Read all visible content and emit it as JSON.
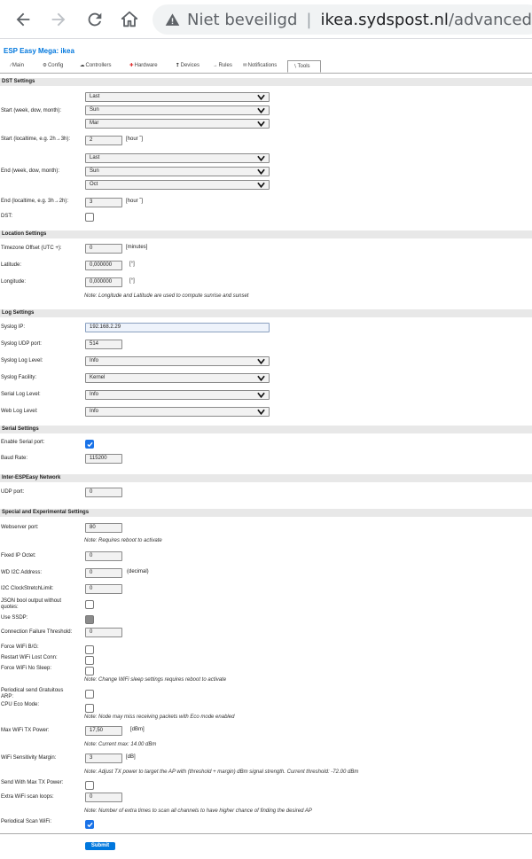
{
  "browser": {
    "security_label": "Niet beveiligd",
    "url_host": "ikea.sydspost.nl",
    "url_path": "/advanced"
  },
  "app": {
    "title": "ESP Easy Mega: ikea",
    "accent_color": "#0077dd"
  },
  "tabs": [
    {
      "label": "Main",
      "icon": "main-icon"
    },
    {
      "label": "Config",
      "icon": "gear-icon"
    },
    {
      "label": "Controllers",
      "icon": "cloud-icon"
    },
    {
      "label": "Hardware",
      "icon": "pin-icon"
    },
    {
      "label": "Devices",
      "icon": "bulb-icon"
    },
    {
      "label": "Rules",
      "icon": "arrow-icon"
    },
    {
      "label": "Notifications",
      "icon": "mail-icon"
    },
    {
      "label": "Tools",
      "icon": "wrench-icon",
      "active": true
    }
  ],
  "dst": {
    "header": "DST Settings",
    "start_label": "Start (week, dow, month):",
    "start_week": "Last",
    "start_dow": "Sun",
    "start_month": "Mar",
    "start_time_label": "Start (localtime, e.g. 2h→3h):",
    "start_time": "2",
    "start_time_unit": "[hour ˜]",
    "end_label": "End (week, dow, month):",
    "end_week": "Last",
    "end_dow": "Sun",
    "end_month": "Oct",
    "end_time_label": "End (localtime, e.g. 3h→2h):",
    "end_time": "3",
    "end_time_unit": "[hour ˜]",
    "dst_label": "DST:"
  },
  "location": {
    "header": "Location Settings",
    "tz_label": "Timezone Offset (UTC +):",
    "tz_value": "0",
    "tz_unit": "[minutes]",
    "lat_label": "Latitude:",
    "lat_value": "0,000000",
    "lat_unit": "[°]",
    "lon_label": "Longitude:",
    "lon_value": "0,000000",
    "lon_unit": "[°]",
    "note": "Note: Longitude and Latitude are used to compute sunrise and sunset"
  },
  "log": {
    "header": "Log Settings",
    "syslog_ip_label": "Syslog IP:",
    "syslog_ip": "192.168.2.29",
    "syslog_port_label": "Syslog UDP port:",
    "syslog_port": "514",
    "syslog_level_label": "Syslog Log Level:",
    "syslog_level": "Info",
    "facility_label": "Syslog Facility:",
    "facility": "Kernel",
    "serial_level_label": "Serial Log Level:",
    "serial_level": "Info",
    "web_level_label": "Web Log Level:",
    "web_level": "Info"
  },
  "serial": {
    "header": "Serial Settings",
    "enable_label": "Enable Serial port:",
    "enable_checked": true,
    "baud_label": "Baud Rate:",
    "baud": "115200"
  },
  "inter": {
    "header": "Inter-ESPEasy Network",
    "udp_label": "UDP port:",
    "udp": "0"
  },
  "special": {
    "header": "Special and Experimental Settings",
    "webport_label": "Webserver port:",
    "webport": "80",
    "webport_note": "Note: Requires reboot to activate",
    "fixed_ip_label": "Fixed IP Octet:",
    "fixed_ip": "0",
    "wd_label": "WD I2C Address:",
    "wd": "0",
    "wd_unit": "(decimal)",
    "i2c_label": "I2C ClockStretchLimit:",
    "i2c": "0",
    "json_label": "JSON bool output without quotes:",
    "ssdp_label": "Use SSDP:",
    "conn_fail_label": "Connection Failure Threshold:",
    "conn_fail": "0",
    "force_bg_label": "Force WiFi B/G:",
    "restart_label": "Restart WiFi Lost Conn:",
    "nosleep_label": "Force WiFi No Sleep:",
    "nosleep_note": "Note: Change WiFi sleep settings requires reboot to activate",
    "garp_label": "Periodical send Gratuitous ARP:",
    "eco_label": "CPU Eco Mode:",
    "eco_note": "Note: Node may miss receiving packets with Eco mode enabled",
    "txpower_label": "Max WiFi TX Power:",
    "txpower": "17,50",
    "txpower_unit": "[dBm]",
    "txpower_note": "Note: Current max: 14.00 dBm",
    "sens_label": "WiFi Sensitivity Margin:",
    "sens": "3",
    "sens_unit": "[dB]",
    "sens_note": "Note: Adjust TX power to target the AP with (threshold + margin) dBm signal strength. Current threshold: -72.00 dBm",
    "sendmax_label": "Send With Max TX Power:",
    "extrascan_label": "Extra WiFi scan loops:",
    "extrascan": "0",
    "extrascan_note": "Note: Number of extra times to scan all channels to have higher chance of finding the desired AP",
    "periodic_label": "Periodical Scan WiFi:",
    "periodic_checked": true
  },
  "submit_label": "Submit"
}
